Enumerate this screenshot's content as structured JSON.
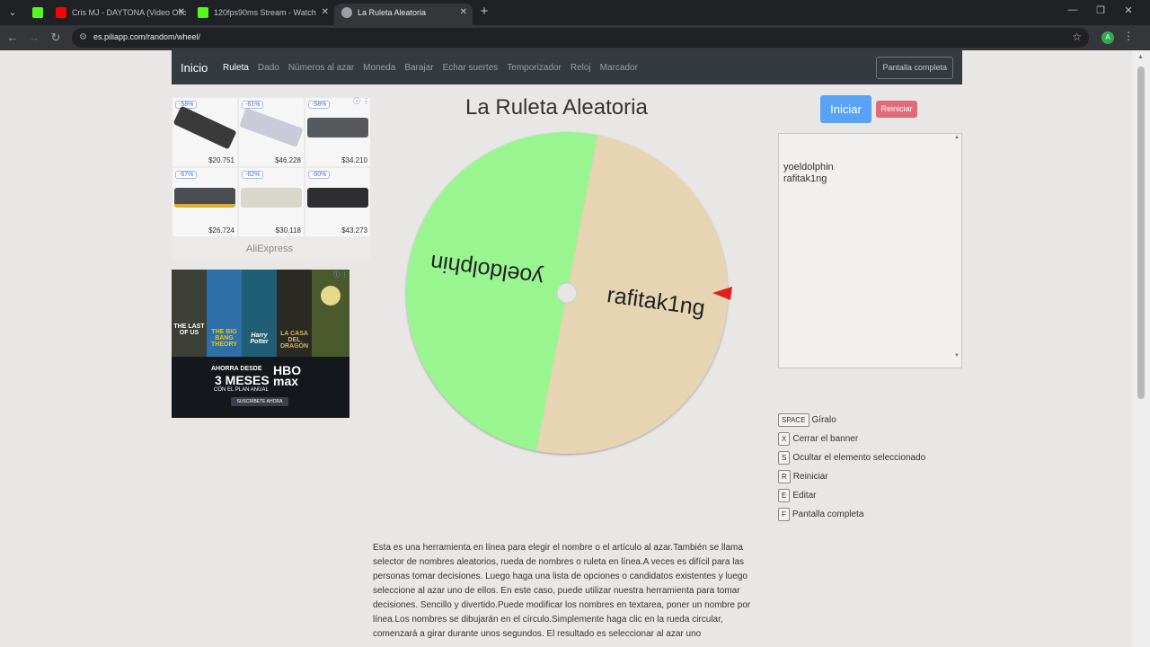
{
  "browser": {
    "tabs": [
      {
        "title": "Cris MJ - DAYTONA (Video Ofic",
        "color": "#ff0000"
      },
      {
        "title": "120fps90ms Stream - Watch",
        "color": "#53fc18"
      },
      {
        "title": "La Ruleta Aleatoria",
        "color": "#9aa0a6"
      }
    ],
    "first_tab_color": "#53fc18",
    "url": "es.piliapp.com/random/wheel/",
    "profile_initial": "A"
  },
  "nav": {
    "brand": "Inicio",
    "items": [
      "Ruleta",
      "Dado",
      "Números al azar",
      "Moneda",
      "Barajar",
      "Echar suertes",
      "Temporizador",
      "Reloj",
      "Marcador"
    ],
    "active": "Ruleta",
    "fullscreen_label": "Pantalla completa"
  },
  "ads": {
    "products": [
      {
        "discount": "-58%",
        "price": "$20.751"
      },
      {
        "discount": "-61%",
        "price": "$46.228"
      },
      {
        "discount": "-58%",
        "price": "$34.210"
      },
      {
        "discount": "-67%",
        "price": "$26.724"
      },
      {
        "discount": "-62%",
        "price": "$30.118"
      },
      {
        "discount": "-60%",
        "price": "$43.273"
      }
    ],
    "advertiser": "AliExpress",
    "hbo": {
      "posters": [
        "THE LAST OF US",
        "THE BIG BANG THEORY",
        "Harry Potter",
        "LA CASA DEL DRAGÓN",
        ""
      ],
      "line1": "AHORRA DESDE",
      "line2": "3 MESES",
      "line3": "CON EL PLAN ANUAL",
      "logo_top": "HBO",
      "logo_bottom": "max",
      "cta": "SUSCRÍBETE AHORA"
    }
  },
  "main": {
    "title": "La Ruleta Aleatoria",
    "start_label": "Iniciar",
    "reset_label": "Reiniciar",
    "wheel": {
      "segments": [
        {
          "label": "yoeldolphin",
          "color": "#98f590"
        },
        {
          "label": "rafitak1ng",
          "color": "#e6d4b2"
        }
      ],
      "pointer_color": "#e01f1f"
    },
    "names": [
      "yoeldolphin",
      "rafitak1ng"
    ]
  },
  "shortcuts": [
    {
      "key": "SPACE",
      "label": "Gíralo"
    },
    {
      "key": "X",
      "label": "Cerrar el banner"
    },
    {
      "key": "S",
      "label": "Ocultar el elemento seleccionado"
    },
    {
      "key": "R",
      "label": "Reiniciar"
    },
    {
      "key": "E",
      "label": "Editar"
    },
    {
      "key": "F",
      "label": "Pantalla completa"
    }
  ],
  "description": "Esta es una herramienta en línea para elegir el nombre o el artículo al azar.También se llama selector de nombres aleatorios, rueda de nombres o ruleta en línea.A veces es difícil para las personas tomar decisiones. Luego haga una lista de opciones o candidatos existentes y luego seleccione al azar uno de ellos. En este caso, puede utilizar nuestra herramienta para tomar decisiones. Sencillo y divertido.Puede modificar los nombres en textarea, poner un nombre por línea.Los nombres se dibujarán en el círculo.Simplemente haga clic en la rueda circular, comenzará a girar durante unos segundos. El resultado es seleccionar al azar uno"
}
